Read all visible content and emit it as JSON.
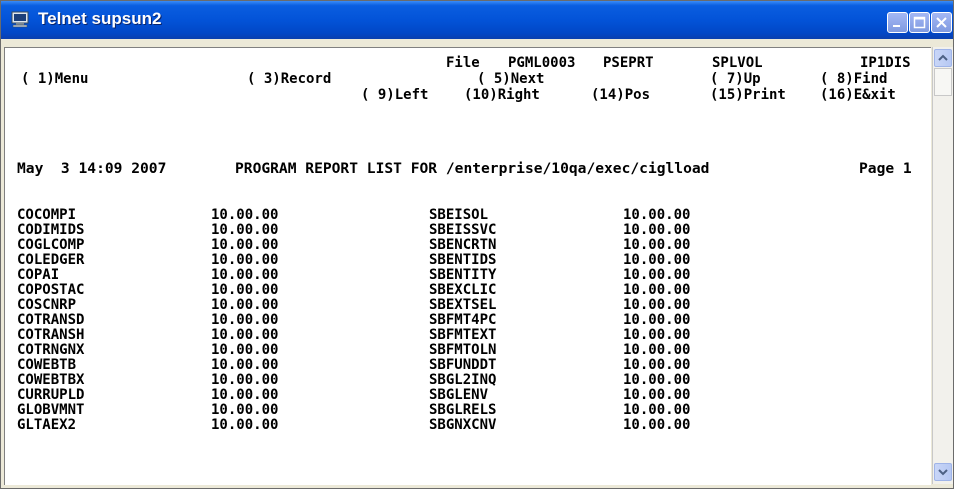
{
  "window": {
    "title": "Telnet supsun2"
  },
  "icons": {
    "app": "terminal-icon",
    "minimize": "minimize-icon",
    "maximize": "maximize-icon",
    "close": "close-icon",
    "scroll_up": "arrow-up-icon",
    "scroll_down": "arrow-down-icon"
  },
  "colors": {
    "titlebar": "#0353d8",
    "screen_bg": "#ffffff",
    "text": "#000000"
  },
  "header": {
    "file_label": "File",
    "file_name": "PGML0003",
    "program": "PSEPRT",
    "spool": "SPLVOL",
    "device": "IP1DIS"
  },
  "fkeys": {
    "f1": "( 1)Menu",
    "f3": "( 3)Record",
    "f5": "( 5)Next",
    "f7": "( 7)Up",
    "f8": "( 8)Find",
    "f9": "( 9)Left",
    "f10": "(10)Right",
    "f14": "(14)Pos",
    "f15": "(15)Print",
    "f16": "(16)E&xit"
  },
  "report": {
    "date": "May  3 14:09 2007",
    "title": "PROGRAM REPORT LIST FOR /enterprise/10qa/exec/ciglload",
    "page": "Page 1"
  },
  "rows": [
    {
      "prog1": "COCOMPI",
      "ver1": "10.00.00",
      "prog2": "SBEISOL",
      "ver2": "10.00.00"
    },
    {
      "prog1": "CODIMIDS",
      "ver1": "10.00.00",
      "prog2": "SBEISSVC",
      "ver2": "10.00.00"
    },
    {
      "prog1": "COGLCOMP",
      "ver1": "10.00.00",
      "prog2": "SBENCRTN",
      "ver2": "10.00.00"
    },
    {
      "prog1": "COLEDGER",
      "ver1": "10.00.00",
      "prog2": "SBENTIDS",
      "ver2": "10.00.00"
    },
    {
      "prog1": "COPAI",
      "ver1": "10.00.00",
      "prog2": "SBENTITY",
      "ver2": "10.00.00"
    },
    {
      "prog1": "COPOSTAC",
      "ver1": "10.00.00",
      "prog2": "SBEXCLIC",
      "ver2": "10.00.00"
    },
    {
      "prog1": "COSCNRP",
      "ver1": "10.00.00",
      "prog2": "SBEXTSEL",
      "ver2": "10.00.00"
    },
    {
      "prog1": "COTRANSD",
      "ver1": "10.00.00",
      "prog2": "SBFMT4PC",
      "ver2": "10.00.00"
    },
    {
      "prog1": "COTRANSH",
      "ver1": "10.00.00",
      "prog2": "SBFMTEXT",
      "ver2": "10.00.00"
    },
    {
      "prog1": "COTRNGNX",
      "ver1": "10.00.00",
      "prog2": "SBFMTOLN",
      "ver2": "10.00.00"
    },
    {
      "prog1": "COWEBTB",
      "ver1": "10.00.00",
      "prog2": "SBFUNDDT",
      "ver2": "10.00.00"
    },
    {
      "prog1": "COWEBTBX",
      "ver1": "10.00.00",
      "prog2": "SBGL2INQ",
      "ver2": "10.00.00"
    },
    {
      "prog1": "CURRUPLD",
      "ver1": "10.00.00",
      "prog2": "SBGLENV",
      "ver2": "10.00.00"
    },
    {
      "prog1": "GLOBVMNT",
      "ver1": "10.00.00",
      "prog2": "SBGLRELS",
      "ver2": "10.00.00"
    },
    {
      "prog1": "GLTAEX2",
      "ver1": "10.00.00",
      "prog2": "SBGNXCNV",
      "ver2": "10.00.00"
    }
  ]
}
